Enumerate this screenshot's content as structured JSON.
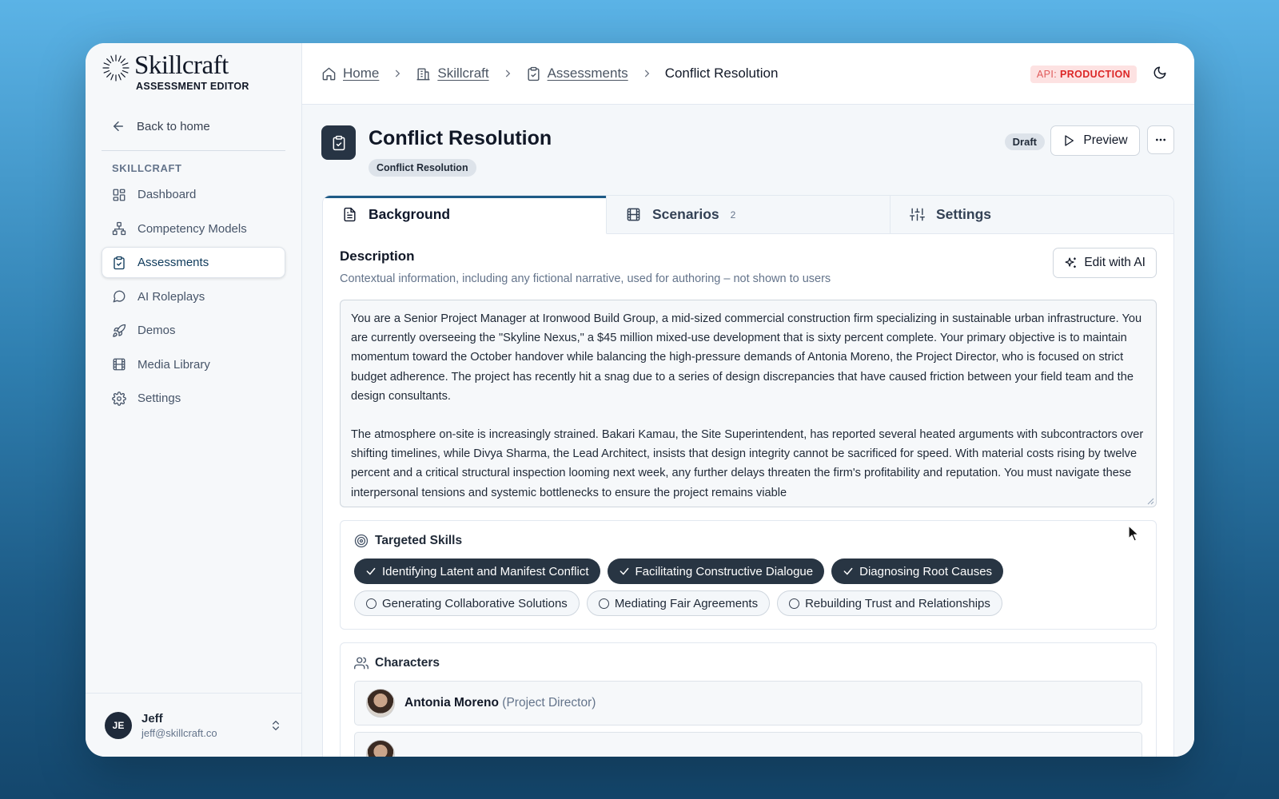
{
  "brand": {
    "name": "Skillcraft",
    "subtitle": "ASSESSMENT EDITOR"
  },
  "sidebar": {
    "back_label": "Back to home",
    "section_label": "SKILLCRAFT",
    "items": [
      {
        "label": "Dashboard",
        "icon": "dashboard-icon"
      },
      {
        "label": "Competency Models",
        "icon": "network-icon"
      },
      {
        "label": "Assessments",
        "icon": "clipboard-check-icon",
        "active": true
      },
      {
        "label": "AI Roleplays",
        "icon": "chat-bubble-icon"
      },
      {
        "label": "Demos",
        "icon": "rocket-icon"
      },
      {
        "label": "Media Library",
        "icon": "film-icon"
      },
      {
        "label": "Settings",
        "icon": "gear-icon"
      }
    ],
    "user": {
      "initials": "JE",
      "name": "Jeff",
      "email": "jeff@skillcraft.co"
    }
  },
  "breadcrumb": {
    "items": [
      "Home",
      "Skillcraft",
      "Assessments"
    ],
    "current": "Conflict Resolution"
  },
  "api_badge": {
    "prefix": "API:",
    "env": "PRODUCTION"
  },
  "page": {
    "title": "Conflict Resolution",
    "tag": "Conflict Resolution",
    "status": "Draft",
    "preview_label": "Preview"
  },
  "tabs": [
    {
      "label": "Background"
    },
    {
      "label": "Scenarios",
      "count": "2"
    },
    {
      "label": "Settings"
    }
  ],
  "description": {
    "title": "Description",
    "subtitle": "Contextual information, including any fictional narrative, used for authoring – not shown to users",
    "edit_label": "Edit with AI",
    "paragraph1": "You are a Senior Project Manager at Ironwood Build Group, a mid-sized commercial construction firm specializing in sustainable urban infrastructure. You are currently overseeing the \"Skyline Nexus,\" a $45 million mixed-use development that is sixty percent complete. Your primary objective is to maintain momentum toward the October handover while balancing the high-pressure demands of Antonia Moreno, the Project Director, who is focused on strict budget adherence. The project has recently hit a snag due to a series of design discrepancies that have caused friction between your field team and the design consultants.",
    "paragraph2": "The atmosphere on-site is increasingly strained. Bakari Kamau, the Site Superintendent, has reported several heated arguments with subcontractors over shifting timelines, while Divya Sharma, the Lead Architect, insists that design integrity cannot be sacrificed for speed. With material costs rising by twelve percent and a critical structural inspection looming next week, any further delays threaten the firm's profitability and reputation. You must navigate these interpersonal tensions and systemic bottlenecks to ensure the project remains viable"
  },
  "skills": {
    "title": "Targeted Skills",
    "items": [
      {
        "label": "Identifying Latent and Manifest Conflict",
        "selected": true
      },
      {
        "label": "Facilitating Constructive Dialogue",
        "selected": true
      },
      {
        "label": "Diagnosing Root Causes",
        "selected": true
      },
      {
        "label": "Generating Collaborative Solutions",
        "selected": false
      },
      {
        "label": "Mediating Fair Agreements",
        "selected": false
      },
      {
        "label": "Rebuilding Trust and Relationships",
        "selected": false
      }
    ]
  },
  "characters": {
    "title": "Characters",
    "items": [
      {
        "name": "Antonia Moreno",
        "role": "(Project Director)"
      }
    ]
  },
  "colors": {
    "accent": "#1d5a86",
    "chip_selected": "#283543",
    "api_badge": "#dc2626"
  }
}
